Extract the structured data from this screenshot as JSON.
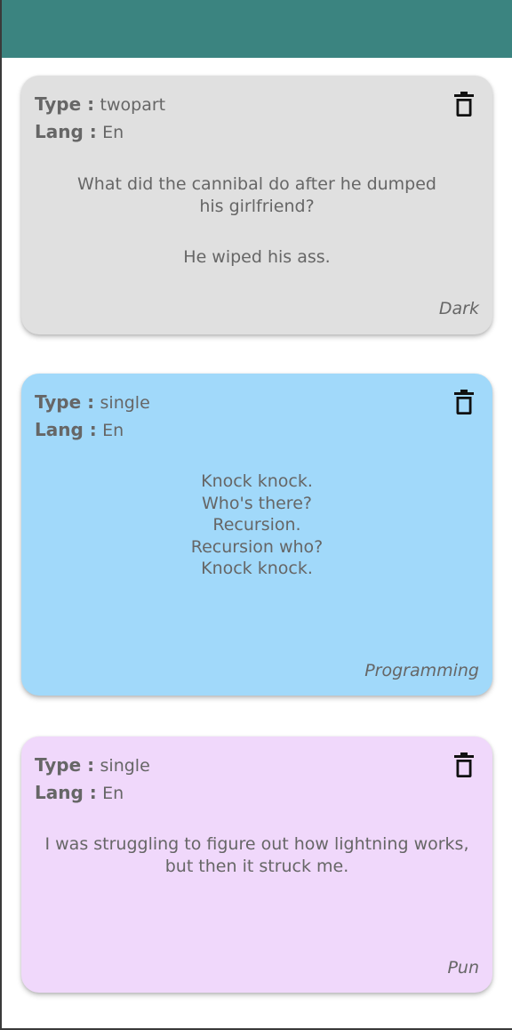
{
  "app": {
    "appbar_color": "#3b8480"
  },
  "labels": {
    "type_key": "Type :",
    "lang_key": "Lang :"
  },
  "jokes": [
    {
      "type": "twopart",
      "lang": "En",
      "setup": "What did the cannibal do after he dumped his girlfriend?",
      "delivery": "He wiped his ass.",
      "category": "Dark",
      "color": "#e0e0e0",
      "icon": "trash-icon"
    },
    {
      "type": "single",
      "lang": "En",
      "joke": "Knock knock.\nWho's there?\nRecursion.\nRecursion who?\nKnock knock.",
      "category": "Programming",
      "color": "#a1d9fa",
      "icon": "trash-icon"
    },
    {
      "type": "single",
      "lang": "En",
      "joke": "I was struggling to figure out how lightning works, but then it struck me.",
      "category": "Pun",
      "color": "#f0d8fb",
      "icon": "trash-icon"
    }
  ]
}
